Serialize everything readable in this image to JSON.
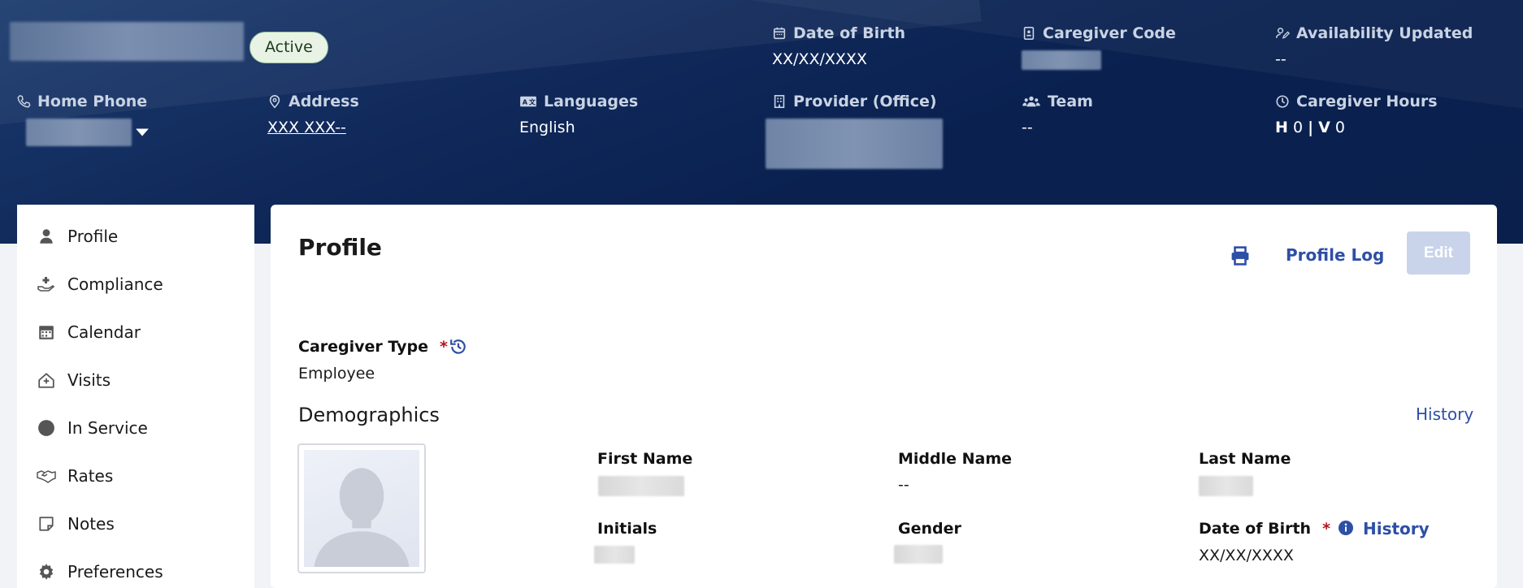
{
  "header": {
    "status": "Active",
    "date_of_birth": {
      "label": "Date of Birth",
      "value": "XX/XX/XXXX"
    },
    "caregiver_code": {
      "label": "Caregiver Code"
    },
    "availability_updated": {
      "label": "Availability Updated",
      "value": "--"
    },
    "home_phone": {
      "label": "Home Phone"
    },
    "address": {
      "label": "Address",
      "value": "XXX XXX--"
    },
    "languages": {
      "label": "Languages",
      "value": "English"
    },
    "provider": {
      "label": "Provider (Office)"
    },
    "team": {
      "label": "Team",
      "value": "--"
    },
    "caregiver_hours": {
      "label": "Caregiver Hours",
      "h_label": "H",
      "h_value": "0",
      "separator": "|",
      "v_label": "V",
      "v_value": "0"
    }
  },
  "sidebar": {
    "items": [
      {
        "label": "Profile",
        "icon": "person-icon"
      },
      {
        "label": "Compliance",
        "icon": "hand-plus-icon"
      },
      {
        "label": "Calendar",
        "icon": "calendar-icon"
      },
      {
        "label": "Visits",
        "icon": "house-plus-icon"
      },
      {
        "label": "In Service",
        "icon": "circle-icon"
      },
      {
        "label": "Rates",
        "icon": "handshake-icon"
      },
      {
        "label": "Notes",
        "icon": "note-icon"
      },
      {
        "label": "Preferences",
        "icon": "gear-icon"
      }
    ]
  },
  "main": {
    "title": "Profile",
    "profile_log": "Profile Log",
    "edit": "Edit",
    "caregiver_type": {
      "label": "Caregiver Type",
      "required": "*",
      "value": "Employee"
    },
    "demographics": {
      "title": "Demographics",
      "history": "History"
    },
    "first_name": {
      "label": "First Name"
    },
    "middle_name": {
      "label": "Middle Name",
      "value": "--"
    },
    "last_name": {
      "label": "Last Name"
    },
    "initials": {
      "label": "Initials"
    },
    "gender": {
      "label": "Gender"
    },
    "date_of_birth": {
      "label": "Date of Birth",
      "required": "*",
      "history": "History",
      "value": "XX/XX/XXXX"
    }
  },
  "colors": {
    "header_bg": "#0a2150",
    "accent": "#2d4fa6",
    "required": "#b5121b",
    "status_bg": "#e8f3e6"
  }
}
